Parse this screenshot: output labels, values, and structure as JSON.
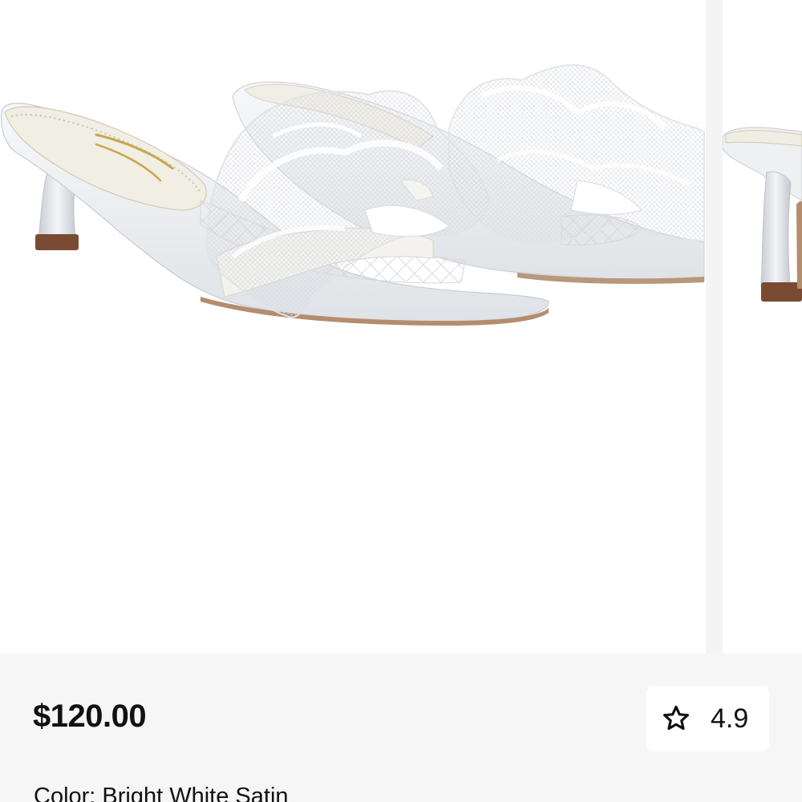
{
  "product": {
    "image_alt": "White satin kitten-heel slide sandals with tulle ruffle strap",
    "insole_script": "Sam Edelman",
    "price": "$120.00",
    "rating": {
      "icon": "star-outline-icon",
      "value": "4.9"
    },
    "color_line": "Color: Bright White Satin"
  }
}
